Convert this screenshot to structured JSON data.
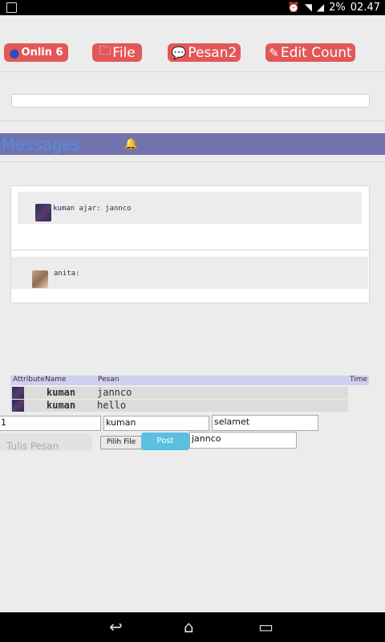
{
  "status": {
    "battery": "2%",
    "time": "02.47"
  },
  "toolbar": {
    "online_label": "Onlin 6",
    "file_label": "File",
    "pesan_label": "Pesan2",
    "edit_label": "Edit Count"
  },
  "messages_title": "Messages",
  "messages": [
    {
      "text": "kuman ajar: jannco"
    },
    {
      "text": "anita:"
    }
  ],
  "table": {
    "headers": [
      "Attribute",
      "Name",
      "Pesan",
      "Time"
    ],
    "rows": [
      {
        "name": "kuman",
        "pesan": "jannco"
      },
      {
        "name": "kuman",
        "pesan": "hello"
      }
    ]
  },
  "form": {
    "field1_value": "1",
    "name_value": "kuman",
    "greeting_value": "selamet",
    "message_placeholder": "Tulis Pesan",
    "file_button": "Pilih File",
    "post_button": "Post",
    "message_value": "jannco"
  }
}
